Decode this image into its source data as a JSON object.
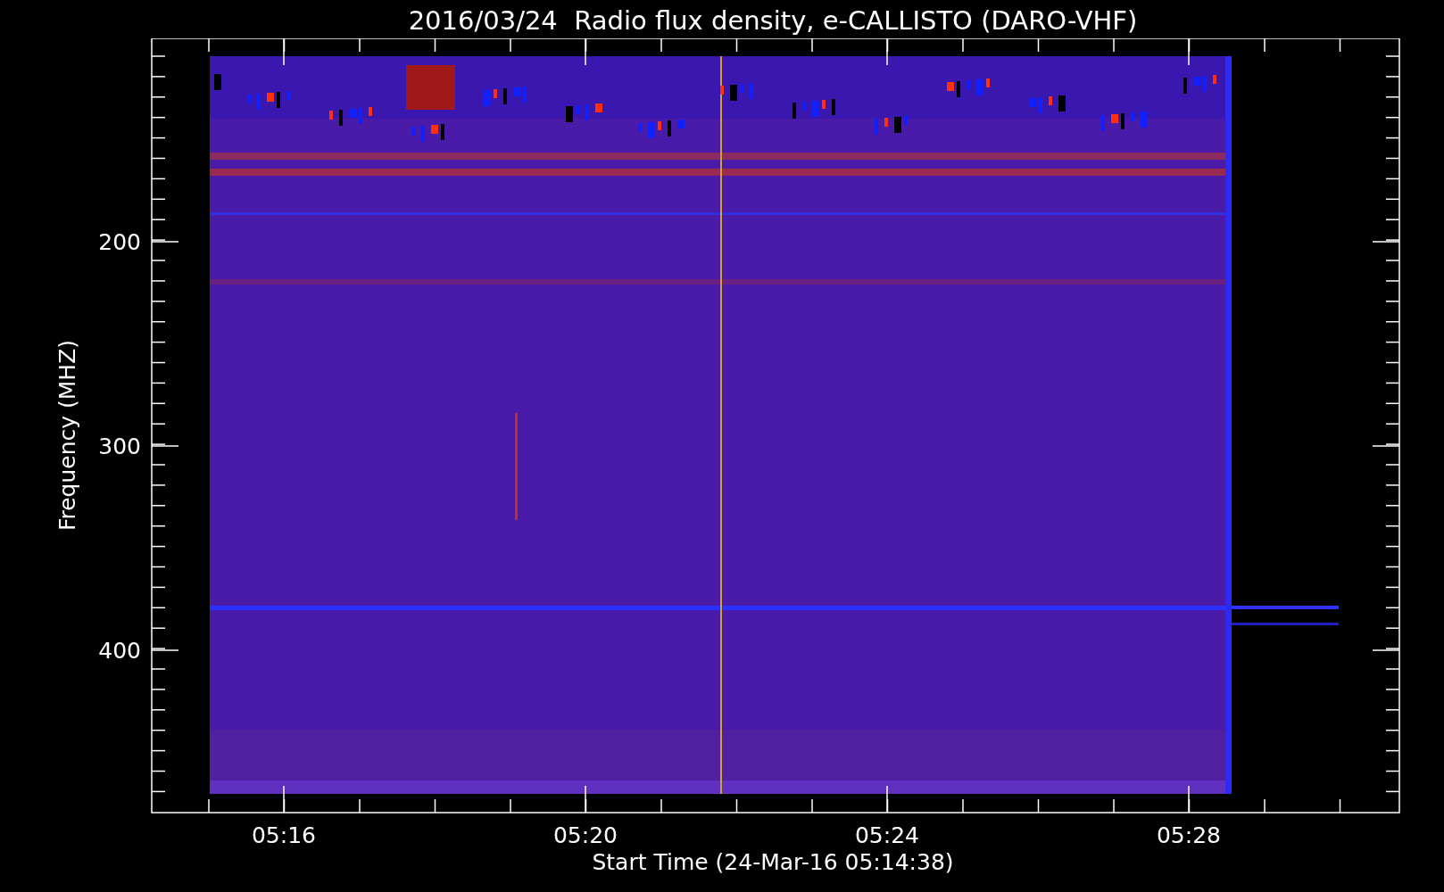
{
  "title": "2016/03/24  Radio flux density, e-CALLISTO (DARO-VHF)",
  "plot": {
    "ylabel": "Frequency (MHZ)",
    "xlabel": "Start Time (24-Mar-16 05:14:38)",
    "yticks": [
      "200",
      "300",
      "400"
    ],
    "xticks": [
      "05:16",
      "05:20",
      "05:24",
      "05:28"
    ]
  }
}
